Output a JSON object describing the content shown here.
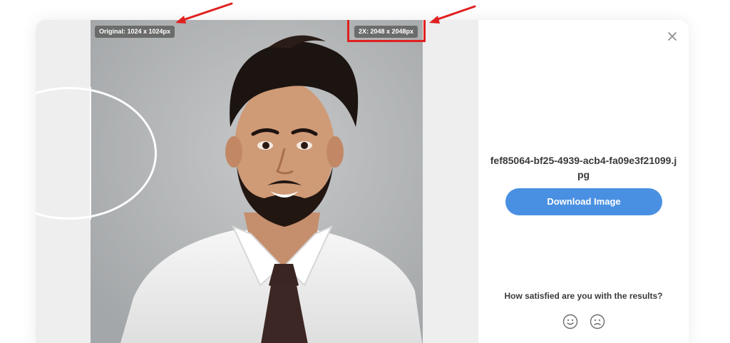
{
  "preview": {
    "original_badge": "Original: 1024 x 1024px",
    "enhanced_badge": "2X: 2048 x 2048px"
  },
  "panel": {
    "close_icon": "close-icon",
    "filename": "fef85064-bf25-4939-acb4-fa09e3f21099.jpg",
    "download_label": "Download Image",
    "survey_question": "How satisfied are you with the results?",
    "feedback_icons": [
      "smile-icon",
      "frown-icon"
    ]
  },
  "colors": {
    "accent": "#4a90e2",
    "annotation": "#e02020",
    "badge": "#5f5f5f"
  }
}
